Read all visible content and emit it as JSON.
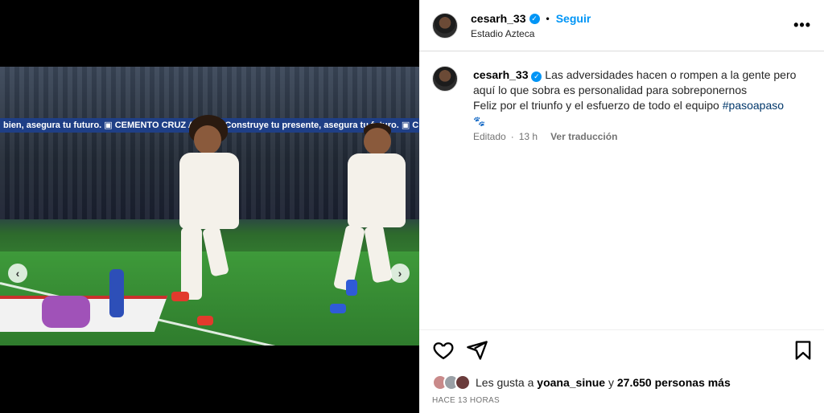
{
  "post": {
    "username": "cesarh_33",
    "verified": true,
    "follow_label": "Seguir",
    "separator": "•",
    "location": "Estadio Azteca",
    "more_icon": "more-horizontal-icon",
    "more_glyph": "•••"
  },
  "media": {
    "ledboard_text": "bien, asegura tu futuro. ▣ CEMENTO CRUZ AZUL ▣ Construye tu presente, asegura tu futuro. ▣ CEMENTO CRUZ",
    "prev_glyph": "‹",
    "next_glyph": "›",
    "carousel": {
      "total": 10,
      "active_index": 3
    }
  },
  "caption": {
    "username": "cesarh_33",
    "text": "Las adversidades hacen o rompen a la gente pero aquí lo que sobra es personalidad para sobreponernos",
    "line2": "Feliz por el triunfo y el esfuerzo de todo el equipo",
    "hashtag": "#pasoapaso",
    "paw": "🐾",
    "edited_label": "Editado",
    "dot": "·",
    "time": "13 h",
    "translate_label": "Ver traducción"
  },
  "engagement": {
    "likes_prefix": "Les gusta a",
    "liker_name": "yoana_sinue",
    "likes_join": "y",
    "likes_count": "27.650 personas más",
    "time_ago": "HACE 13 HORAS"
  },
  "icons": {
    "like": "heart-icon",
    "share": "send-icon",
    "save": "bookmark-icon"
  },
  "colors": {
    "accent": "#0095f6",
    "hashtag": "#00376b",
    "meta_text": "#737373"
  }
}
